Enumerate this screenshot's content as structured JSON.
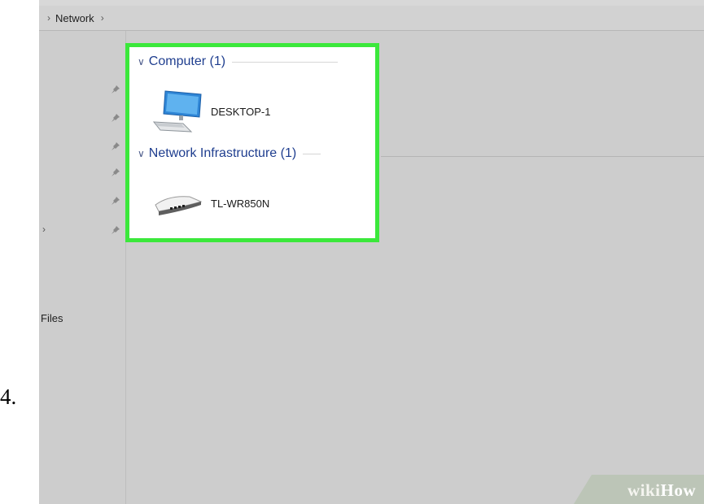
{
  "step": {
    "number": "4."
  },
  "breadcrumb": {
    "location": "Network",
    "separator": "›"
  },
  "nav": {
    "files_label": "Files",
    "pin_count": 6
  },
  "groups": [
    {
      "header": "Computer (1)",
      "device_label": "DESKTOP-1",
      "device_icon": "computer-monitor-icon"
    },
    {
      "header": "Network Infrastructure (1)",
      "device_label": "TL-WR850N",
      "device_icon": "router-icon"
    }
  ],
  "colors": {
    "highlight": "#3be83b",
    "group_header": "#1f3e8f",
    "window_bg": "#cdcdcd"
  },
  "watermark": {
    "wiki": "wiki",
    "how": "How"
  }
}
